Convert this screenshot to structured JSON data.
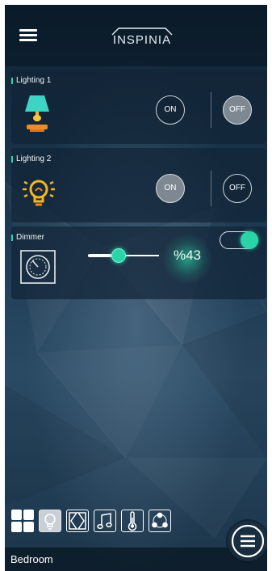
{
  "header": {
    "logo_text": "INSPINIA",
    "menu_icon": "hamburger-menu-icon"
  },
  "devices": [
    {
      "title": "Lighting 1",
      "icon": "table-lamp-icon",
      "on_label": "ON",
      "off_label": "OFF",
      "state": "off"
    },
    {
      "title": "Lighting 2",
      "icon": "light-bulb-icon",
      "on_label": "ON",
      "off_label": "OFF",
      "state": "on"
    }
  ],
  "dimmer": {
    "title": "Dimmer",
    "icon": "dimmer-knob-icon",
    "value_label": "%43",
    "level": 0.43,
    "enabled": true
  },
  "tabs": [
    {
      "icon": "dashboard-grid-icon",
      "selected": false
    },
    {
      "icon": "light-bulb-icon",
      "selected": true
    },
    {
      "icon": "curtains-icon",
      "selected": false
    },
    {
      "icon": "music-note-icon",
      "selected": false
    },
    {
      "icon": "thermometer-icon",
      "selected": false
    },
    {
      "icon": "scenes-icon",
      "selected": false
    }
  ],
  "footer": {
    "room_label": "Bedroom",
    "fab_icon": "menu-circle-icon"
  },
  "colors": {
    "accent": "#2ad3a8",
    "lamp_shade": "#3fd3c4",
    "bulb": "#f5b623"
  }
}
